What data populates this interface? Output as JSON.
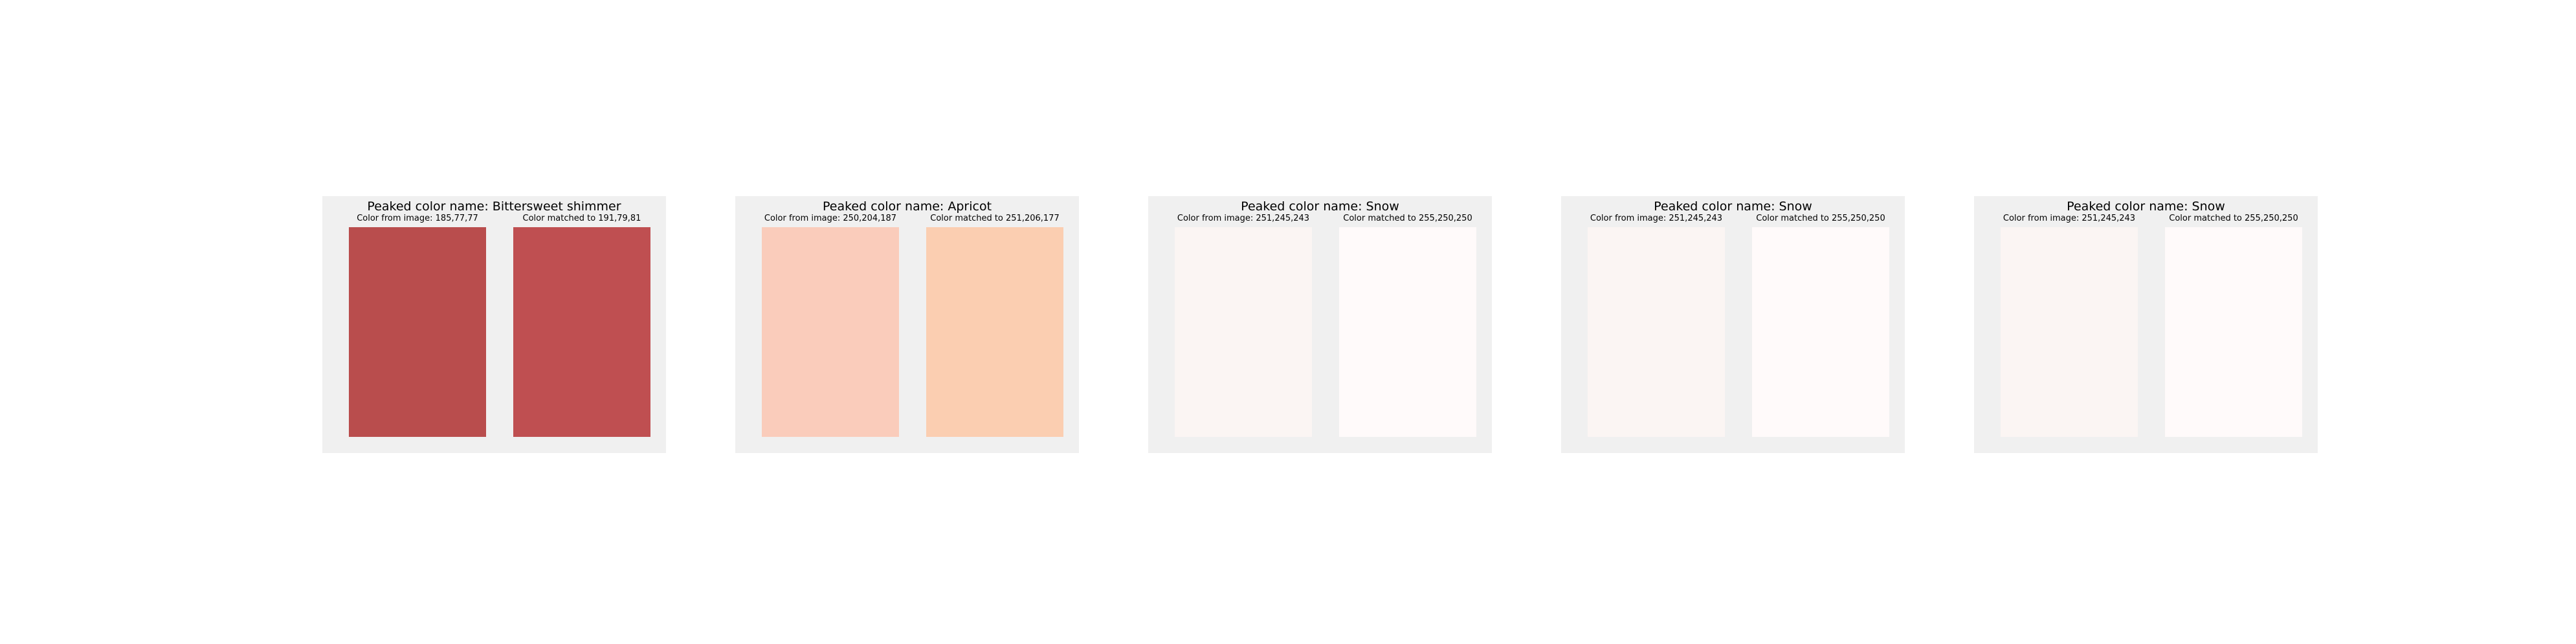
{
  "panels": [
    {
      "title": "Peaked color name: Bittersweet shimmer",
      "image_label": "Color from image: 185,77,77",
      "matched_label": "Color matched to 191,79,81",
      "image_color": "#b94d4d",
      "matched_color": "#bf4f51"
    },
    {
      "title": "Peaked color name: Apricot",
      "image_label": "Color from image: 250,204,187",
      "matched_label": "Color matched to 251,206,177",
      "image_color": "#faccbb",
      "matched_color": "#fbceb1"
    },
    {
      "title": "Peaked color name: Snow",
      "image_label": "Color from image: 251,245,243",
      "matched_label": "Color matched to 255,250,250",
      "image_color": "#fbf5f3",
      "matched_color": "#fffafa"
    },
    {
      "title": "Peaked color name: Snow",
      "image_label": "Color from image: 251,245,243",
      "matched_label": "Color matched to 255,250,250",
      "image_color": "#fbf5f3",
      "matched_color": "#fffafa"
    },
    {
      "title": "Peaked color name: Snow",
      "image_label": "Color from image: 251,245,243",
      "matched_label": "Color matched to 255,250,250",
      "image_color": "#fbf5f3",
      "matched_color": "#fffafa"
    }
  ]
}
